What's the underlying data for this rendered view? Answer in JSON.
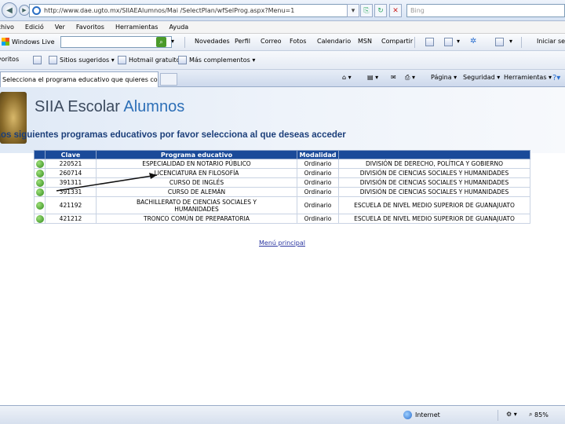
{
  "browser": {
    "address": "http://www.dae.ugto.mx/SIIAEAlumnos/Mai /SelectPlan/wfSelProg.aspx?Menu=1",
    "search_placeholder": "Bing",
    "menu": [
      "Archivo",
      "Edició",
      "Ver",
      "Favoritos",
      "Herramientas",
      "Ayuda"
    ],
    "live_label": "Windows Live",
    "live_links": [
      "Novedades",
      "Perfil",
      "Correo",
      "Fotos",
      "Calendario",
      "MSN",
      "Compartir"
    ],
    "live_signin": "Iniciar sesión",
    "favorites_label": "Favoritos",
    "favorites": [
      "Sitios sugeridos",
      "Hotmail gratuito",
      "Más complementos"
    ],
    "tab_title": "Selecciona el programa educativo que quieres consultar",
    "commands": [
      "Página",
      "Seguridad",
      "Herramientas"
    ],
    "status_zone": "Internet",
    "zoom": "85%"
  },
  "page": {
    "title_main": "SIIA Escolar",
    "title_sub": "Alumnos",
    "subtitle": "Los siguientes programas educativos por favor selecciona al que deseas acceder",
    "columns": [
      "",
      "Clave",
      "Programa educativo",
      "Modalidad",
      ""
    ],
    "rows": [
      {
        "clave": "220521",
        "programa": "ESPECIALIDAD EN NOTARIO PÚBLICO",
        "modalidad": "Ordinario",
        "division": "DIVISIÓN DE DERECHO, POLÍTICA Y GOBIERNO"
      },
      {
        "clave": "260714",
        "programa": "LICENCIATURA EN FILOSOFÍA",
        "modalidad": "Ordinario",
        "division": "DIVISIÓN DE CIENCIAS SOCIALES Y HUMANIDADES"
      },
      {
        "clave": "391311",
        "programa": "CURSO DE INGLÉS",
        "modalidad": "Ordinario",
        "division": "DIVISIÓN DE CIENCIAS SOCIALES Y HUMANIDADES"
      },
      {
        "clave": "391331",
        "programa": "CURSO DE ALEMÁN",
        "modalidad": "Ordinario",
        "division": "DIVISIÓN DE CIENCIAS SOCIALES Y HUMANIDADES"
      },
      {
        "clave": "421192",
        "programa": "BACHILLERATO DE CIENCIAS SOCIALES Y HUMANIDADES",
        "modalidad": "Ordinario",
        "division": "ESCUELA DE NIVEL MEDIO SUPERIOR DE GUANAJUATO"
      },
      {
        "clave": "421212",
        "programa": "TRONCO COMÚN DE PREPARATORIA",
        "modalidad": "Ordinario",
        "division": "ESCUELA DE NIVEL MEDIO SUPERIOR DE GUANAJUATO"
      }
    ],
    "menu_link": "Menú principal"
  }
}
